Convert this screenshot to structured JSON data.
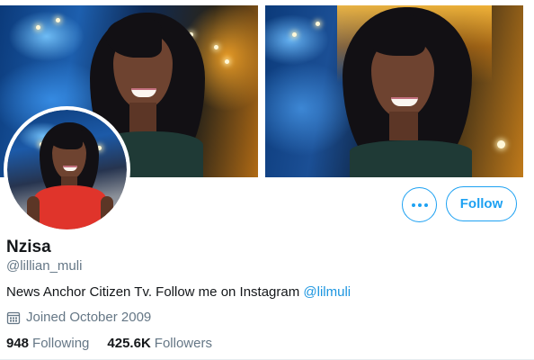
{
  "profile": {
    "display_name": "Nzisa",
    "handle": "@lillian_muli",
    "bio_text": "News Anchor Citizen Tv. Follow me on Instagram ",
    "bio_link": "@lilmuli",
    "joined": "Joined October 2009",
    "following_count": "948",
    "following_label": "Following",
    "followers_count": "425.6K",
    "followers_label": "Followers"
  },
  "actions": {
    "follow_label": "Follow",
    "more_icon": "more-options-icon"
  },
  "icons": {
    "joined": "calendar-icon"
  },
  "colors": {
    "accent": "#1da1f2",
    "link": "#1b95e0",
    "secondary_text": "#657786",
    "primary_text": "#14171a"
  }
}
